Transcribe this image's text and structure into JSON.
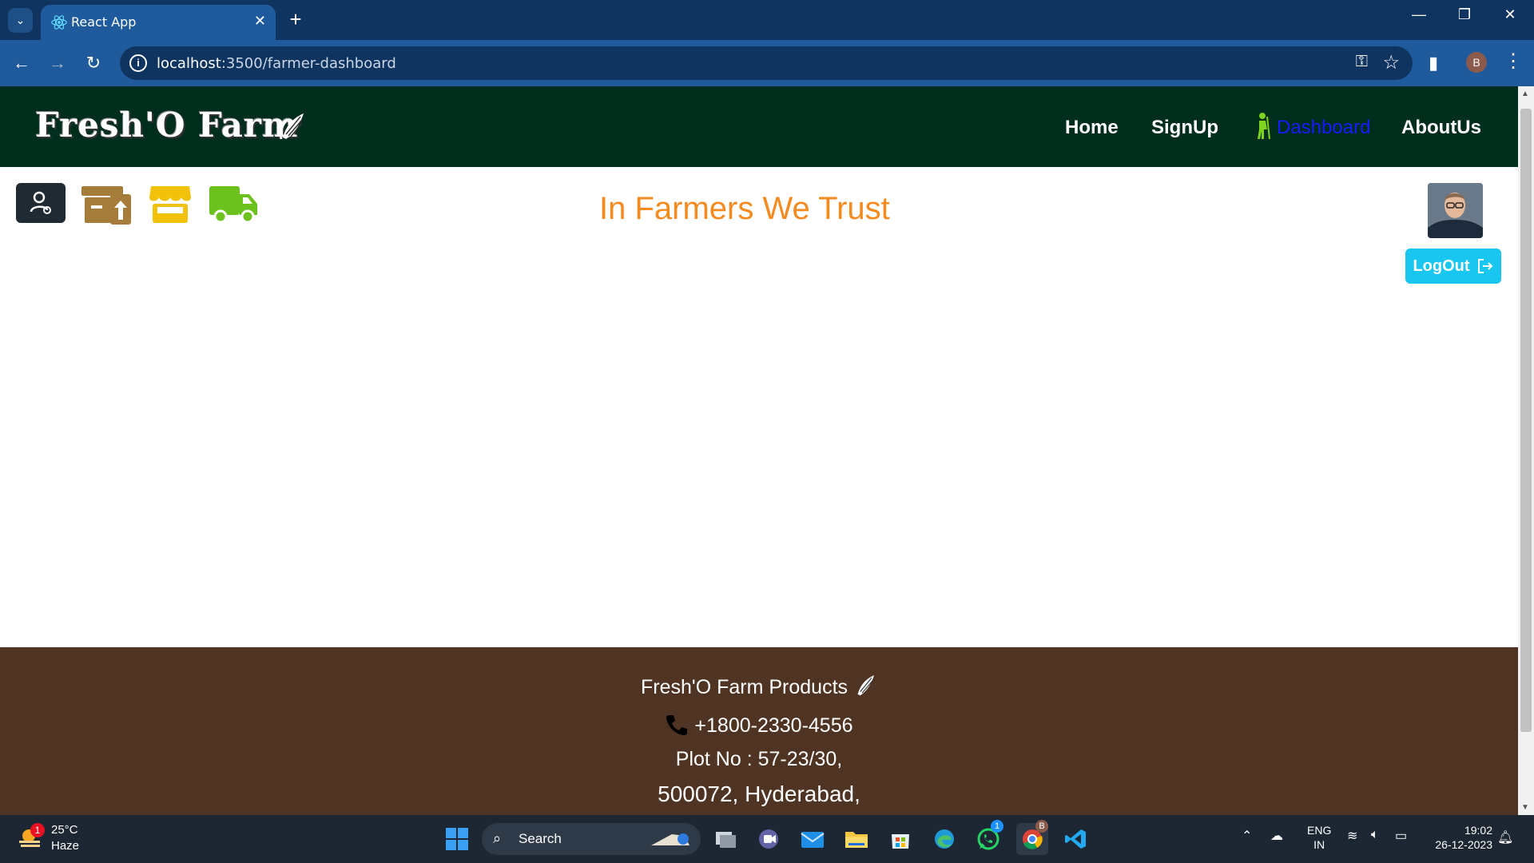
{
  "browser": {
    "tab_title": "React App",
    "url_host": "localhost",
    "url_path": ":3500/farmer-dashboard",
    "profile_initial": "B"
  },
  "header": {
    "logo_text": "Fresh'O Farm",
    "nav": {
      "home": "Home",
      "signup": "SignUp",
      "dashboard": "Dashboard",
      "aboutus": "AboutUs"
    }
  },
  "main": {
    "tagline": "In Farmers We Trust",
    "logout_label": "LogOut"
  },
  "footer": {
    "company": "Fresh'O Farm Products",
    "phone": "+1800-2330-4556",
    "address_line1": "Plot No : 57-23/30,",
    "address_line2": "500072, Hyderabad,"
  },
  "taskbar": {
    "weather_temp": "25°C",
    "weather_condition": "Haze",
    "weather_badge": "1",
    "search_label": "Search",
    "whatsapp_badge": "1",
    "chrome_badge": "B",
    "lang_line1": "ENG",
    "lang_line2": "IN",
    "time": "19:02",
    "date": "26-12-2023"
  },
  "colors": {
    "header_bg": "#002e1c",
    "footer_bg": "#4f3423",
    "tagline": "#f58a1f",
    "logout_bg": "#18c6f0",
    "dashboard_link": "#1a1aff"
  }
}
